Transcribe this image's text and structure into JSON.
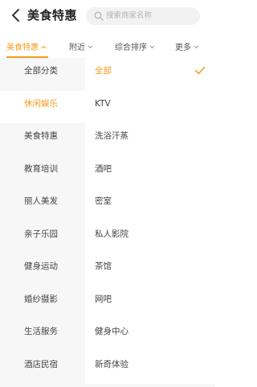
{
  "header": {
    "title": "美食特惠",
    "search_placeholder": "搜索商家名称"
  },
  "filters": [
    {
      "label": "美食特惠",
      "active": true
    },
    {
      "label": "附近",
      "active": false
    },
    {
      "label": "综合排序",
      "active": false
    },
    {
      "label": "更多",
      "active": false
    }
  ],
  "categories": [
    {
      "label": "全部分类",
      "selected": false
    },
    {
      "label": "休闲娱乐",
      "selected": true
    },
    {
      "label": "美食特惠",
      "selected": false
    },
    {
      "label": "教育培训",
      "selected": false
    },
    {
      "label": "丽人美发",
      "selected": false
    },
    {
      "label": "亲子乐园",
      "selected": false
    },
    {
      "label": "健身运动",
      "selected": false
    },
    {
      "label": "婚纱摄影",
      "selected": false
    },
    {
      "label": "生活服务",
      "selected": false
    },
    {
      "label": "酒店民宿",
      "selected": false
    }
  ],
  "subcategories": [
    {
      "label": "全部",
      "selected": true
    },
    {
      "label": "KTV",
      "selected": false
    },
    {
      "label": "洗浴汗蒸",
      "selected": false
    },
    {
      "label": "酒吧",
      "selected": false
    },
    {
      "label": "密室",
      "selected": false
    },
    {
      "label": "私人影院",
      "selected": false
    },
    {
      "label": "茶馆",
      "selected": false
    },
    {
      "label": "网吧",
      "selected": false
    },
    {
      "label": "健身中心",
      "selected": false
    },
    {
      "label": "新奇体验",
      "selected": false
    }
  ],
  "colors": {
    "accent": "#f39b1b",
    "panel_bg": "#f7f7f7",
    "search_bg": "#f2f2f2"
  },
  "icons": {
    "back": "chevron-left-icon",
    "search": "search-icon",
    "filter_caret": "caret-down-icon",
    "selected_mark": "checkmark-icon"
  }
}
